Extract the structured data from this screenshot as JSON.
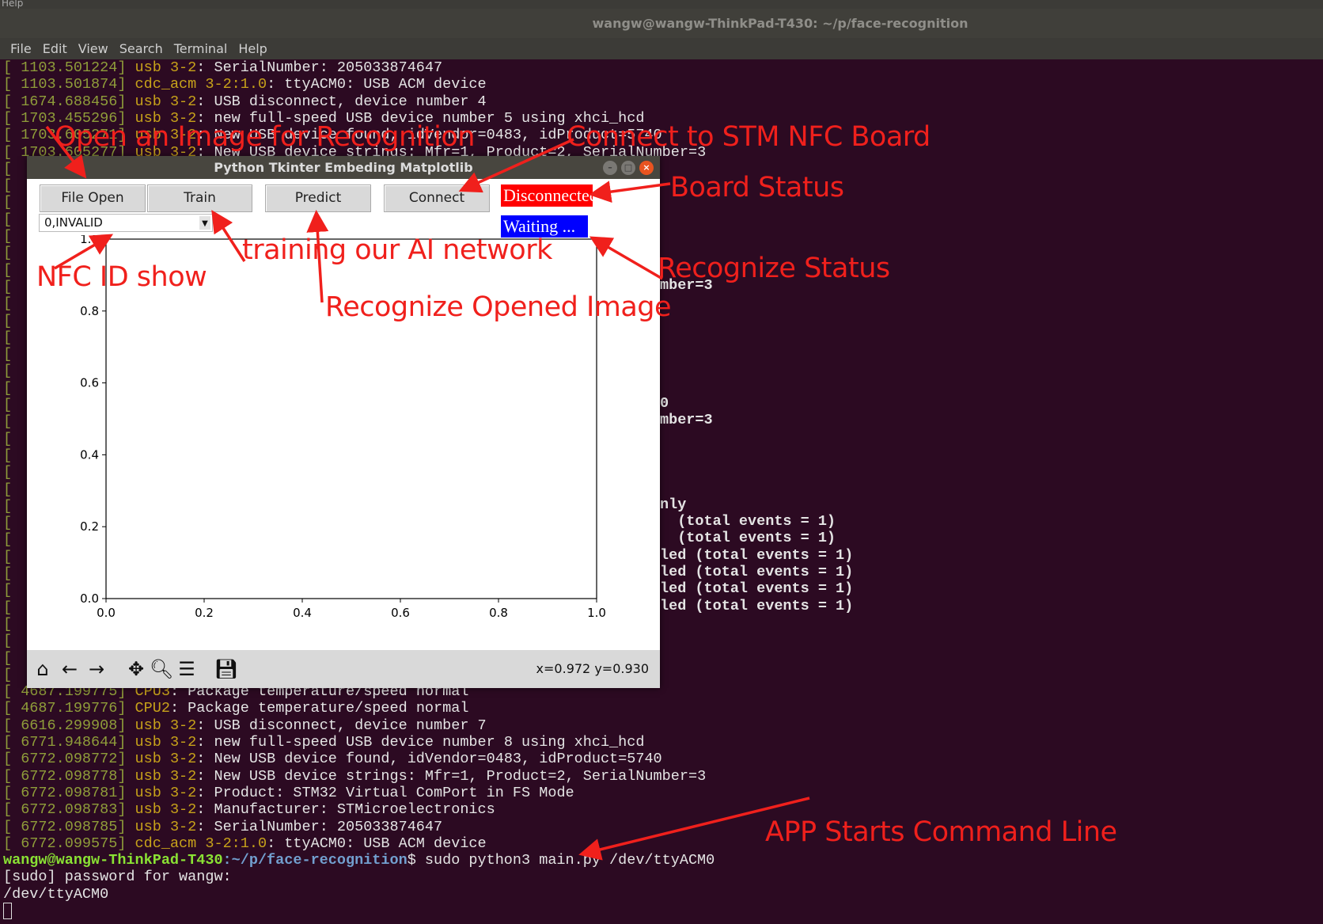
{
  "top_strip": "Help",
  "terminal": {
    "title": "wangw@wangw-ThinkPad-T430: ~/p/face-recognition",
    "menu": [
      "File",
      "Edit",
      "View",
      "Search",
      "Terminal",
      "Help"
    ],
    "lines": [
      {
        "row": 0,
        "ts": "[ 1103.501224]",
        "src": "usb 3-2",
        "msg": ": SerialNumber: 205033874647"
      },
      {
        "row": 1,
        "ts": "[ 1103.501874]",
        "src": "cdc_acm 3-2:1.0",
        "msg": ": ttyACM0: USB ACM device"
      },
      {
        "row": 2,
        "ts": "[ 1674.688456]",
        "src": "usb 3-2",
        "msg": ": USB disconnect, device number 4"
      },
      {
        "row": 3,
        "ts": "[ 1703.455296]",
        "src": "usb 3-2",
        "msg": ": new full-speed USB device number 5 using xhci_hcd"
      },
      {
        "row": 4,
        "ts": "[ 1703.605271]",
        "src": "usb 3-2",
        "msg": ": New USB device found, idVendor=0483, idProduct=5740"
      },
      {
        "row": 5,
        "ts": "[ 1703.605277]",
        "src": "usb 3-2",
        "msg": ": New USB device strings: Mfr=1, Product=2, SerialNumber=3"
      },
      {
        "row": 37,
        "ts": "[ 4687.199775]",
        "src": "CPU3",
        "msg": ": Package temperature/speed normal"
      },
      {
        "row": 38,
        "ts": "[ 4687.199776]",
        "src": "CPU2",
        "msg": ": Package temperature/speed normal"
      },
      {
        "row": 39,
        "ts": "[ 6616.299908]",
        "src": "usb 3-2",
        "msg": ": USB disconnect, device number 7"
      },
      {
        "row": 40,
        "ts": "[ 6771.948644]",
        "src": "usb 3-2",
        "msg": ": new full-speed USB device number 8 using xhci_hcd"
      },
      {
        "row": 41,
        "ts": "[ 6772.098772]",
        "src": "usb 3-2",
        "msg": ": New USB device found, idVendor=0483, idProduct=5740"
      },
      {
        "row": 42,
        "ts": "[ 6772.098778]",
        "src": "usb 3-2",
        "msg": ": New USB device strings: Mfr=1, Product=2, SerialNumber=3"
      },
      {
        "row": 43,
        "ts": "[ 6772.098781]",
        "src": "usb 3-2",
        "msg": ": Product: STM32 Virtual ComPort in FS Mode"
      },
      {
        "row": 44,
        "ts": "[ 6772.098783]",
        "src": "usb 3-2",
        "msg": ": Manufacturer: STMicroelectronics"
      },
      {
        "row": 45,
        "ts": "[ 6772.098785]",
        "src": "usb 3-2",
        "msg": ": SerialNumber: 205033874647"
      },
      {
        "row": 46,
        "ts": "[ 6772.099575]",
        "src": "cdc_acm 3-2:1.0",
        "msg": ": ttyACM0: USB ACM device"
      }
    ],
    "right_fragments": [
      {
        "row": 13,
        "text": "mber=3"
      },
      {
        "row": 20,
        "text": "0"
      },
      {
        "row": 21,
        "text": "mber=3"
      },
      {
        "row": 26,
        "text": "nly"
      },
      {
        "row": 27,
        "text": "  (total events = 1)"
      },
      {
        "row": 28,
        "text": "  (total events = 1)"
      },
      {
        "row": 29,
        "text": "led (total events = 1)"
      },
      {
        "row": 30,
        "text": "led (total events = 1)"
      },
      {
        "row": 31,
        "text": "led (total events = 1)"
      },
      {
        "row": 32,
        "text": "led (total events = 1)"
      }
    ],
    "prompt": {
      "user": "wangw@wangw-ThinkPad-T430",
      "path": ":~/p/face-recognition",
      "command": "$ sudo python3 main.py /dev/ttyACM0"
    },
    "output": [
      "[sudo] password for wangw:",
      "/dev/ttyACM0"
    ]
  },
  "app": {
    "title": "Python Tkinter Embeding Matplotlib",
    "buttons": {
      "file_open": "File Open",
      "train": "Train",
      "predict": "Predict",
      "connect": "Connect"
    },
    "board_status": {
      "text": "Disconnected",
      "color": "#ff0000"
    },
    "recognize_status": {
      "text": "Waiting ...",
      "color": "#0000ff"
    },
    "nfc_id": "0,INVALID",
    "coordinates": "x=0.972 y=0.930",
    "toolbar": [
      "home-icon",
      "back-icon",
      "forward-icon",
      "pan-icon",
      "zoom-icon",
      "configure-subplots-icon",
      "save-icon"
    ]
  },
  "chart_data": {
    "type": "line",
    "series": [],
    "xlim": [
      0,
      1
    ],
    "ylim": [
      0,
      1
    ],
    "xticks": [
      "0.0",
      "0.2",
      "0.4",
      "0.6",
      "0.8",
      "1.0"
    ],
    "yticks": [
      "0.0",
      "0.2",
      "0.4",
      "0.6",
      "0.8",
      "1.0"
    ],
    "grid": false
  },
  "annotations": {
    "open_image": "Open an Image for Recognition",
    "connect": "Connect to STM NFC Board",
    "board_status": "Board Status",
    "train": "training our AI network",
    "nfc_id": "NFC ID show",
    "predict": "Recognize Opened Image",
    "recognize_status": "Recognize Status",
    "app_start": "APP Starts Command Line",
    "color": "#f0201c"
  }
}
